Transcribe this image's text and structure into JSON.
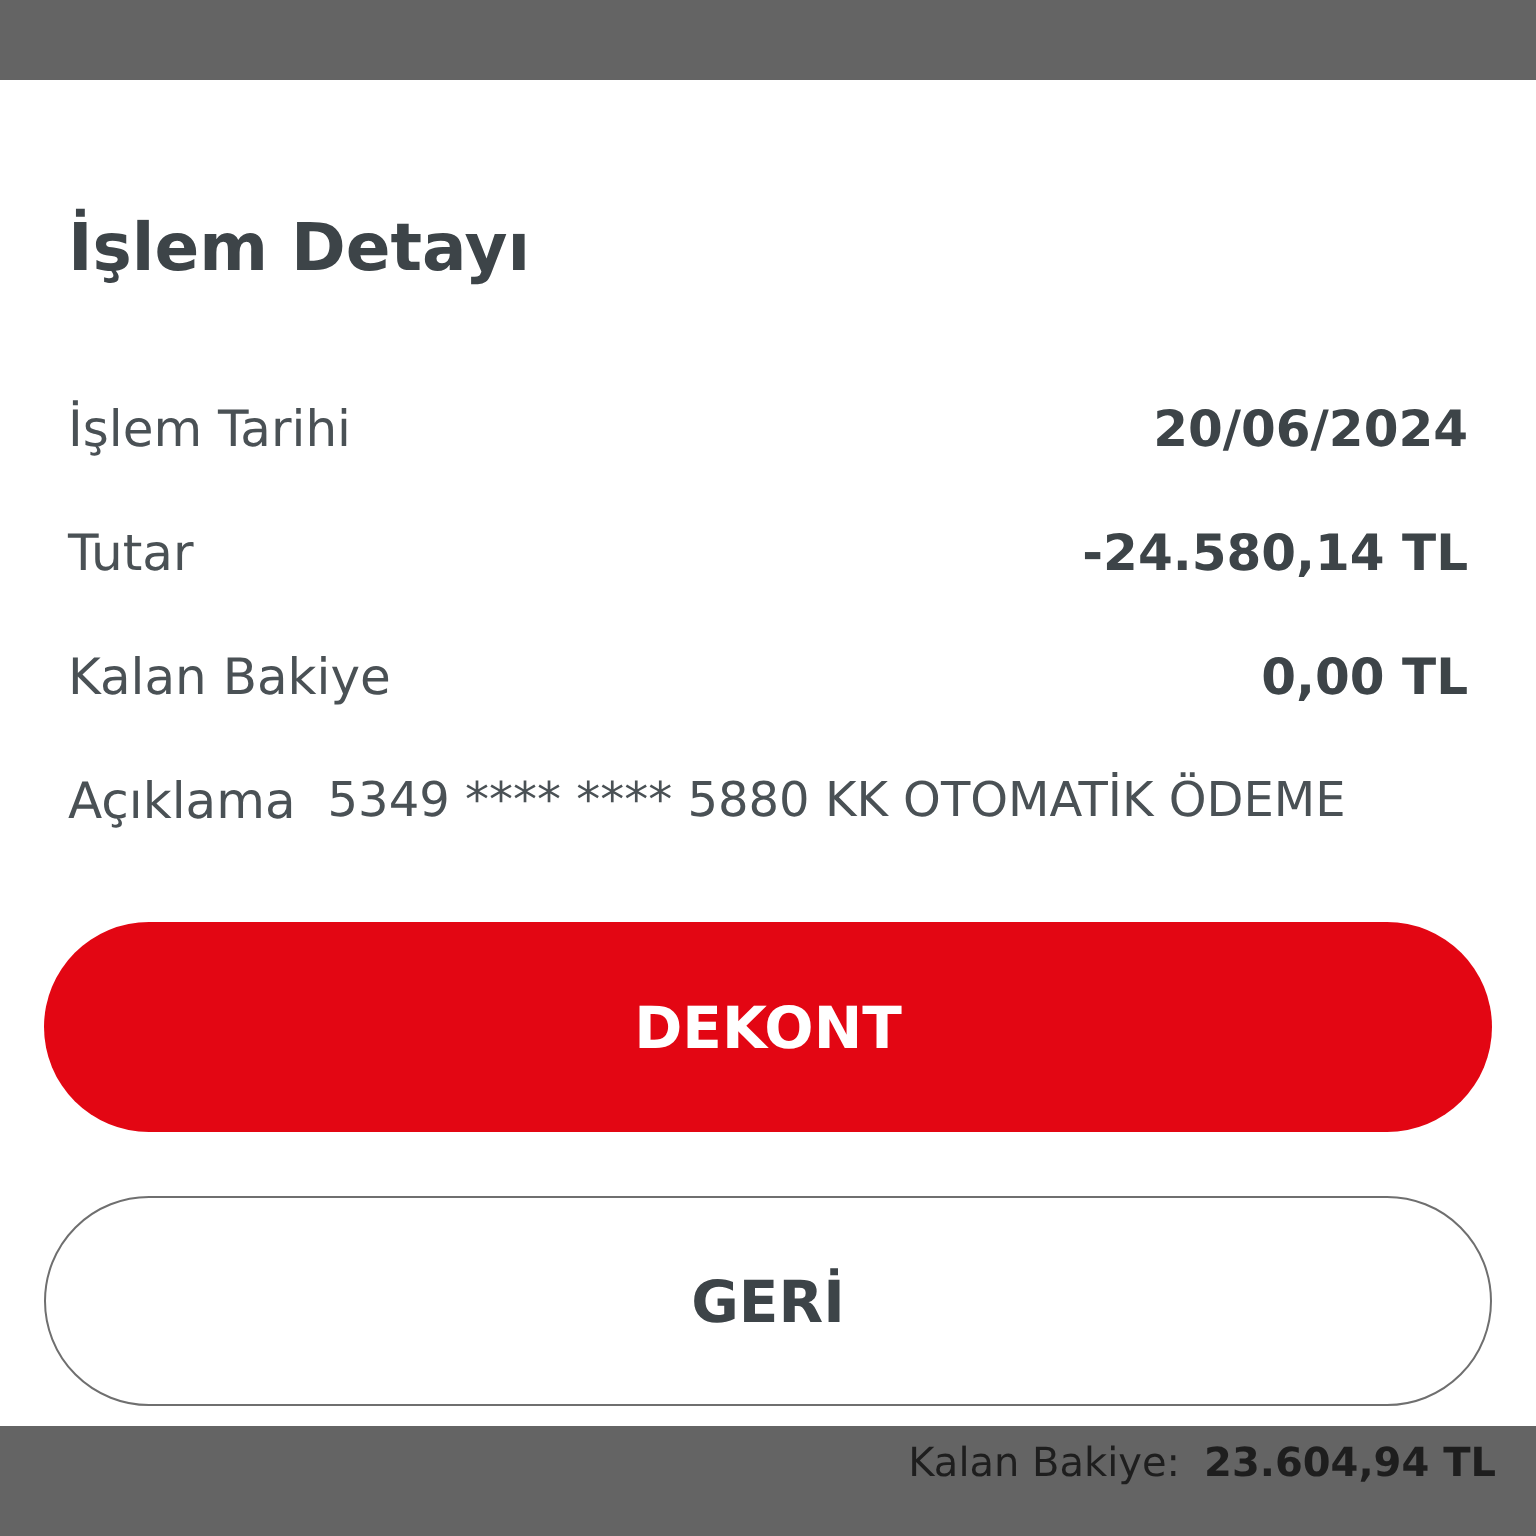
{
  "dialog": {
    "title": "İşlem Detayı",
    "rows": [
      {
        "label": "İşlem Tarihi",
        "value": "20/06/2024"
      },
      {
        "label": "Tutar",
        "value": "-24.580,14 TL"
      },
      {
        "label": "Kalan Bakiye",
        "value": "0,00 TL"
      }
    ],
    "description": {
      "label": "Açıklama",
      "value": "5349 **** **** 5880 KK OTOMATİK ÖDEME"
    },
    "buttons": [
      {
        "label": "DEKONT",
        "kind": "primary"
      },
      {
        "label": "GERİ",
        "kind": "secondary"
      }
    ]
  },
  "background": {
    "balance_label": "Kalan Bakiye:",
    "balance_value": "23.604,94 TL"
  }
}
